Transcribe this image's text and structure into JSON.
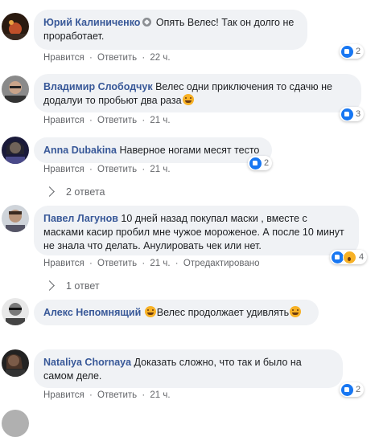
{
  "comments": [
    {
      "author": "Юрий Калиниченко",
      "text": " Опять Велес! Так он долго не проработает.",
      "reactions": "2",
      "like": "Нравится",
      "reply": "Ответить",
      "time": "22 ч."
    },
    {
      "author": "Владимир Слободчук",
      "text": " Велес одни приключения то сдачю не додалуи то пробьют два раза",
      "reactions": "3",
      "like": "Нравится",
      "reply": "Ответить",
      "time": "21 ч."
    },
    {
      "author": "Anna Dubakina",
      "text": " Наверное ногами месят тесто",
      "reactions": "2",
      "like": "Нравится",
      "reply": "Ответить",
      "time": "21 ч.",
      "replies": "2 ответа"
    },
    {
      "author": "Павел Лагунов",
      "text": " 10 дней назад покупал маски , вместе с масками касир пробил мне чужое мороженое. А после 10 минут не знала что делать. Анулировать чек или нет.",
      "reactions": "4",
      "like": "Нравится",
      "reply": "Ответить",
      "time": "21 ч.",
      "edited": "Отредактировано",
      "replies": "1 ответ"
    },
    {
      "author": "Алекс Непомнящий",
      "text": "Велес продолжает удивлять"
    },
    {
      "author": "Nataliya Chornaya",
      "text": " Доказать сложно, что так и было на самом деле.",
      "reactions": "2",
      "like": "Нравится",
      "reply": "Ответить",
      "time": "21 ч."
    }
  ],
  "separator": "·",
  "icons": {
    "verified": "profile-badge-icon",
    "like": "like-reaction-icon",
    "wow": "wow-reaction-icon",
    "emoji": "laughing-emoji-icon",
    "reply_arrow": "reply-arrow-icon"
  },
  "colors": {
    "name": "#385898",
    "bubble": "#f0f2f5",
    "meta": "#65676b",
    "like_blue": "#1877f2"
  }
}
